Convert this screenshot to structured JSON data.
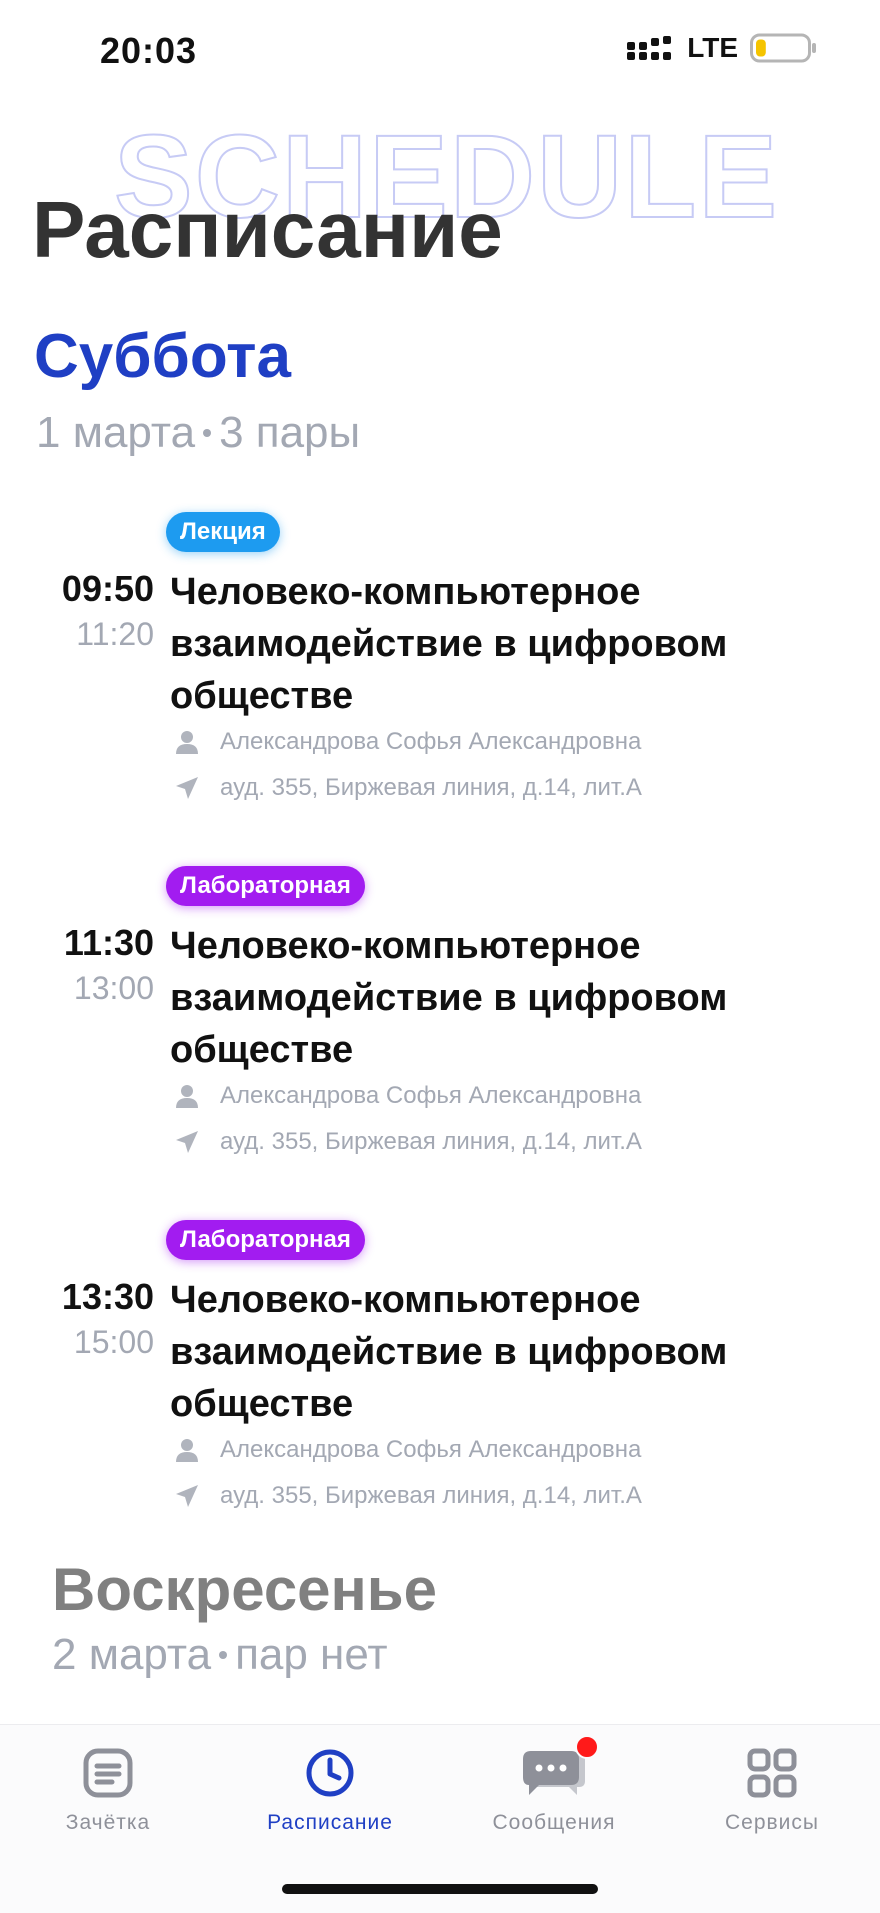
{
  "status_bar": {
    "time": "20:03",
    "network": "LTE",
    "battery_level": 0.2
  },
  "header": {
    "background_title": "SCHEDULE",
    "title": "Расписание"
  },
  "day1": {
    "title": "Суббота",
    "date": "1 марта",
    "count": "3 пары",
    "lessons": [
      {
        "type": "Лекция",
        "start": "09:50",
        "end": "11:20",
        "title": "Человеко-компьютерное взаимодействие в цифровом обществе",
        "teacher": "Александрова Софья Александровна",
        "room": "ауд. 355, Биржевая линия, д.14, лит.А"
      },
      {
        "type": "Лабораторная",
        "start": "11:30",
        "end": "13:00",
        "title": "Человеко-компьютерное взаимодействие в цифровом обществе",
        "teacher": "Александрова Софья Александровна",
        "room": "ауд. 355, Биржевая линия, д.14, лит.А"
      },
      {
        "type": "Лабораторная",
        "start": "13:30",
        "end": "15:00",
        "title": "Человеко-компьютерное взаимодействие в цифровом обществе",
        "teacher": "Александрова Софья Александровна",
        "room": "ауд. 355, Биржевая линия, д.14, лит.А"
      }
    ]
  },
  "day2": {
    "title": "Воскресенье",
    "date": "2 марта",
    "count": "пар нет"
  },
  "tabbar": {
    "items": [
      {
        "label": "Зачётка",
        "icon": "record-book-icon"
      },
      {
        "label": "Расписание",
        "icon": "clock-icon",
        "active": true
      },
      {
        "label": "Сообщения",
        "icon": "chat-icon",
        "badge": true
      },
      {
        "label": "Сервисы",
        "icon": "grid-icon"
      }
    ]
  },
  "colors": {
    "accent": "#1f3fc4",
    "lecture_badge": "#1d9bf0",
    "lab_badge": "#a21cf0",
    "muted_text": "#a3a8b3",
    "notification": "#ff1a1a"
  }
}
